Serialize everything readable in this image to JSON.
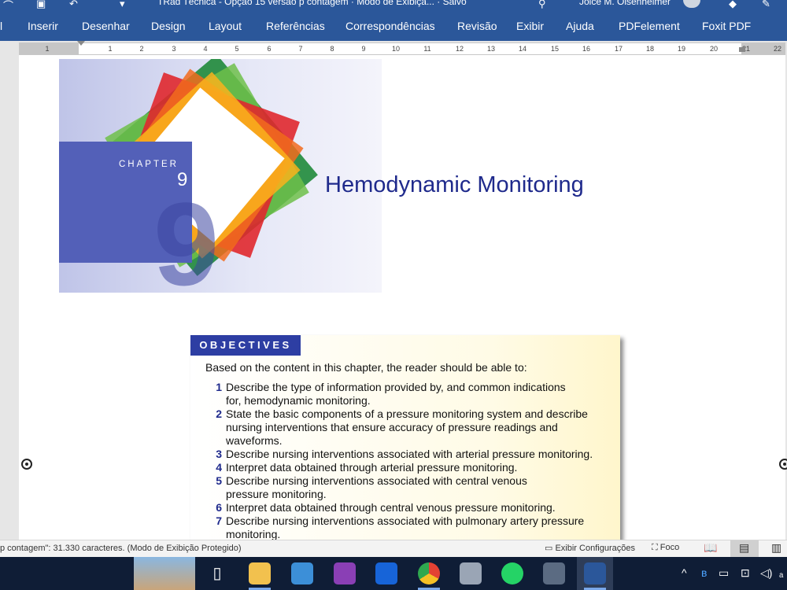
{
  "title_bar": {
    "document_title": "TRad Técnica - Opção 15 versão p contagem  ·  Modo de Exibiçã...  ·  Salvo",
    "user_name": "Joice M. Olsenheimer"
  },
  "menu": {
    "items": [
      "l",
      "Inserir",
      "Desenhar",
      "Design",
      "Layout",
      "Referências",
      "Correspondências",
      "Revisão",
      "Exibir",
      "Ajuda",
      "PDFelement",
      "Foxit PDF"
    ]
  },
  "ruler": {
    "ticks": [
      "1",
      "1",
      "2",
      "3",
      "4",
      "5",
      "6",
      "7",
      "8",
      "9",
      "10",
      "11",
      "12",
      "13",
      "14",
      "15",
      "16",
      "17",
      "18",
      "19",
      "20",
      "21",
      "22"
    ]
  },
  "document": {
    "chapter_label": "CHAPTER",
    "chapter_number": "9",
    "title": "Hemodynamic Monitoring",
    "objectives_heading": "OBJECTIVES",
    "objectives_intro": "Based on the content in this chapter, the reader should be able to:",
    "objectives": [
      {
        "num": "1",
        "text": "Describe the type of information provided by, and common indications for, hemodynamic monitoring."
      },
      {
        "num": "2",
        "text": "State the basic components of a pressure monitoring system and describe nursing interventions that ensure accuracy of pressure readings and waveforms."
      },
      {
        "num": "3",
        "text": "Describe nursing interventions associated with arterial pressure monitoring."
      },
      {
        "num": "4",
        "text": "Interpret data obtained through arterial pressure monitoring."
      },
      {
        "num": "5",
        "text": "Describe nursing interventions associated with central venous pressure monitoring."
      },
      {
        "num": "6",
        "text": "Interpret data obtained through central venous pressure monitoring."
      },
      {
        "num": "7",
        "text": "Describe nursing interventions associated with pulmonary artery pressure monitoring."
      }
    ]
  },
  "status_bar": {
    "word_count": "p contagem\": 31.330 caracteres.  (Modo de Exibição Protegido)",
    "display_settings": "Exibir Configurações",
    "focus": "Foco"
  },
  "taskbar": {
    "apps": [
      "landmark-thumbnail",
      "task-view",
      "file-explorer",
      "laptop-app",
      "rar-archiver",
      "pdf-app",
      "chrome",
      "remote-desktop",
      "whatsapp",
      "calculator",
      "word"
    ]
  }
}
